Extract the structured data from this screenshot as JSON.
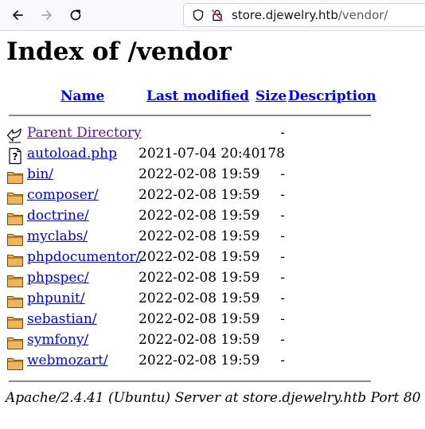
{
  "browser": {
    "url_host": "store.djewelry.htb",
    "url_path": "/vendor/"
  },
  "page": {
    "title": "Index of /vendor",
    "columns": {
      "name": "Name",
      "last_modified": "Last modified",
      "size": "Size",
      "description": "Description"
    },
    "entries": [
      {
        "name": "Parent Directory",
        "date": "",
        "size": "-",
        "icon": "back-arrow-icon",
        "visited": true
      },
      {
        "name": "autoload.php",
        "date": "2021-07-04 20:40",
        "size": "178",
        "icon": "unknown-file-icon",
        "visited": false
      },
      {
        "name": "bin/",
        "date": "2022-02-08 19:59",
        "size": "-",
        "icon": "folder-icon",
        "visited": false
      },
      {
        "name": "composer/",
        "date": "2022-02-08 19:59",
        "size": "-",
        "icon": "folder-icon",
        "visited": false
      },
      {
        "name": "doctrine/",
        "date": "2022-02-08 19:59",
        "size": "-",
        "icon": "folder-icon",
        "visited": false
      },
      {
        "name": "myclabs/",
        "date": "2022-02-08 19:59",
        "size": "-",
        "icon": "folder-icon",
        "visited": false
      },
      {
        "name": "phpdocumentor/",
        "date": "2022-02-08 19:59",
        "size": "-",
        "icon": "folder-icon",
        "visited": false
      },
      {
        "name": "phpspec/",
        "date": "2022-02-08 19:59",
        "size": "-",
        "icon": "folder-icon",
        "visited": false
      },
      {
        "name": "phpunit/",
        "date": "2022-02-08 19:59",
        "size": "-",
        "icon": "folder-icon",
        "visited": false
      },
      {
        "name": "sebastian/",
        "date": "2022-02-08 19:59",
        "size": "-",
        "icon": "folder-icon",
        "visited": false
      },
      {
        "name": "symfony/",
        "date": "2022-02-08 19:59",
        "size": "-",
        "icon": "folder-icon",
        "visited": false
      },
      {
        "name": "webmozart/",
        "date": "2022-02-08 19:59",
        "size": "-",
        "icon": "folder-icon",
        "visited": false
      }
    ],
    "footer": "Apache/2.4.41 (Ubuntu) Server at store.djewelry.htb Port 80"
  },
  "colors": {
    "link": "#0000ee",
    "visited_link": "#551a8b",
    "folder_fill": "#f0b45a"
  }
}
